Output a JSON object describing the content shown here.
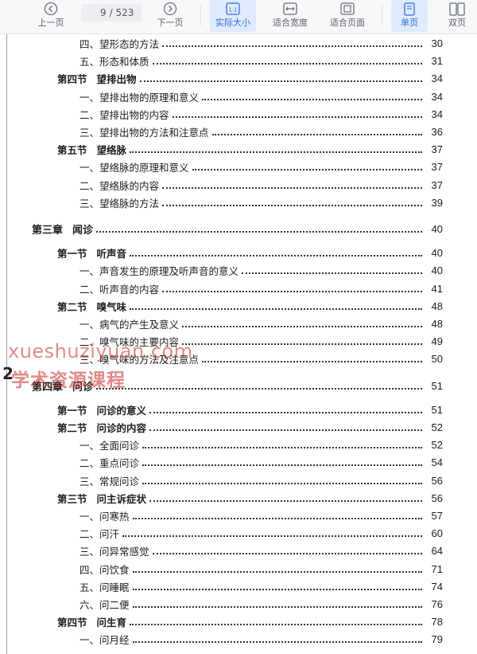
{
  "toolbar": {
    "prev_label": "上一页",
    "next_label": "下一页",
    "current_page": "9",
    "total_pages": "/ 523",
    "actual_size_label": "实际大小",
    "fit_width_label": "适合宽度",
    "fit_page_label": "适合页面",
    "single_page_label": "单页",
    "double_page_label": "双页",
    "accent": "#2f6fe0"
  },
  "toc": [
    {
      "level": "item",
      "title": "四、望形态的方法",
      "page": "30"
    },
    {
      "level": "item",
      "title": "五、形态和体质",
      "page": "31"
    },
    {
      "level": "section",
      "num": "第四节",
      "title": "望排出物",
      "page": "34"
    },
    {
      "level": "item",
      "title": "一、望排出物的原理和意义",
      "page": "34"
    },
    {
      "level": "item",
      "title": "二、望排出物的内容",
      "page": "34"
    },
    {
      "level": "item",
      "title": "三、望排出物的方法和注意点",
      "page": "36"
    },
    {
      "level": "section",
      "num": "第五节",
      "title": "望络脉",
      "page": "37"
    },
    {
      "level": "item",
      "title": "一、望络脉的原理和意义",
      "page": "37"
    },
    {
      "level": "item",
      "title": "二、望络脉的内容",
      "page": "37"
    },
    {
      "level": "item",
      "title": "三、望络脉的方法",
      "page": "39"
    },
    {
      "level": "chapter",
      "num": "第三章",
      "title": "闻诊",
      "page": "40"
    },
    {
      "level": "section",
      "num": "第一节",
      "title": "听声音",
      "page": "40"
    },
    {
      "level": "item",
      "title": "一、声音发生的原理及听声音的意义",
      "page": "40"
    },
    {
      "level": "item",
      "title": "二、听声音的内容",
      "page": "41"
    },
    {
      "level": "section",
      "num": "第二节",
      "title": "嗅气味",
      "page": "48"
    },
    {
      "level": "item",
      "title": "一、病气的产生及意义",
      "page": "48"
    },
    {
      "level": "item",
      "title": "二、嗅气味的主要内容",
      "page": "49"
    },
    {
      "level": "item",
      "title": "三、嗅气味的方法及注意点",
      "page": "50"
    },
    {
      "level": "chapter",
      "num": "第四章",
      "title": "问诊",
      "page": "51"
    },
    {
      "level": "section",
      "num": "第一节",
      "title": "问诊的意义",
      "page": "51"
    },
    {
      "level": "section",
      "num": "第二节",
      "title": "问诊的内容",
      "page": "52"
    },
    {
      "level": "item",
      "title": "一、全面问诊",
      "page": "52"
    },
    {
      "level": "item",
      "title": "二、重点问诊",
      "page": "54"
    },
    {
      "level": "item",
      "title": "三、常规问诊",
      "page": "56"
    },
    {
      "level": "section",
      "num": "第三节",
      "title": "问主诉症状",
      "page": "56"
    },
    {
      "level": "item",
      "title": "一、问寒热",
      "page": "57"
    },
    {
      "level": "item",
      "title": "二、问汗",
      "page": "60"
    },
    {
      "level": "item",
      "title": "三、问异常感觉",
      "page": "64"
    },
    {
      "level": "item",
      "title": "四、问饮食",
      "page": "71"
    },
    {
      "level": "item",
      "title": "五、问睡眠",
      "page": "74"
    },
    {
      "level": "item",
      "title": "六、问二便",
      "page": "76"
    },
    {
      "level": "section",
      "num": "第四节",
      "title": "问生育",
      "page": "78"
    },
    {
      "level": "item",
      "title": "一、问月经",
      "page": "79"
    }
  ],
  "watermark": {
    "line1": "xueshuziyuan.com",
    "line2": "学术资源课程",
    "mark": "2"
  }
}
